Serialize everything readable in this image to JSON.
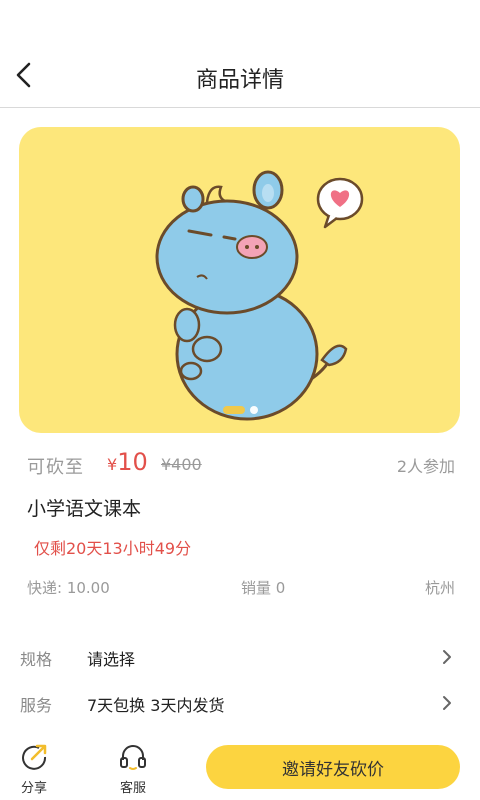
{
  "header": {
    "title": "商品详情"
  },
  "banner": {
    "slide_count": 2,
    "active_index": 0
  },
  "price": {
    "cut_label": "可砍至",
    "currency": "¥",
    "current": "10",
    "original": "¥400",
    "participants": "2人参加",
    "accent_color": "#e2504a"
  },
  "product": {
    "name": "小学语文课本",
    "countdown": "仅剩20天13小时49分"
  },
  "meta": {
    "courier": "快递: 10.00",
    "sales": "销量 0",
    "city": "杭州"
  },
  "options": [
    {
      "label": "规格",
      "value": "请选择"
    },
    {
      "label": "服务",
      "value": "7天包换  3天内发货"
    }
  ],
  "bottom": {
    "share_label": "分享",
    "service_label": "客服",
    "invite_label": "邀请好友砍价",
    "button_color": "#fcd440"
  }
}
